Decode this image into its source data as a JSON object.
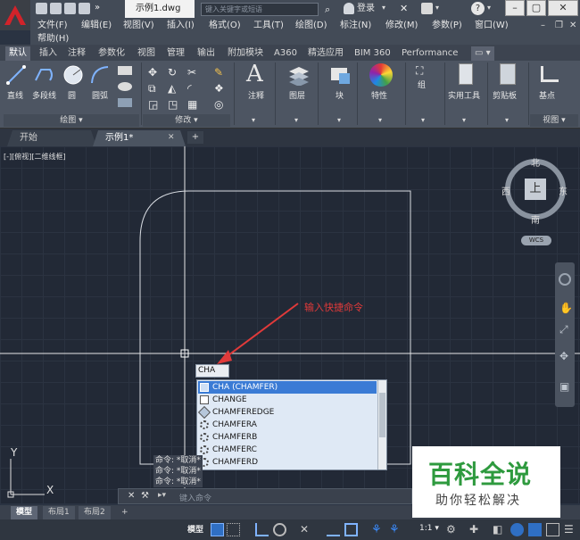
{
  "app": {
    "doc_title": "示例1.dwg",
    "search_placeholder": "键入关键字或短语",
    "login": "登录"
  },
  "menu": {
    "row1": [
      "文件(F)",
      "编辑(E)",
      "视图(V)",
      "插入(I)",
      "格式(O)",
      "工具(T)",
      "绘图(D)",
      "标注(N)",
      "修改(M)",
      "参数(P)",
      "窗口(W)"
    ],
    "row2": [
      "帮助(H)"
    ]
  },
  "ribbon": {
    "tabs": [
      "默认",
      "插入",
      "注释",
      "参数化",
      "视图",
      "管理",
      "输出",
      "附加模块",
      "A360",
      "精选应用",
      "BIM 360",
      "Performance"
    ],
    "active_tab": "默认",
    "buttons": {
      "line": "直线",
      "polyline": "多段线",
      "circle": "圆",
      "arc": "圆弧",
      "annotate": "注释",
      "layers": "图层",
      "block": "块",
      "properties": "特性",
      "group": "组",
      "utilities": "实用工具",
      "clipboard": "剪贴板",
      "base": "基点"
    },
    "panel_footers": {
      "draw": "绘图 ▾",
      "modify": "修改 ▾",
      "view": "视图 ▾"
    }
  },
  "doc_tabs": {
    "start": "开始",
    "current": "示例1*",
    "add": "+"
  },
  "viewport": {
    "label": "[-][俯视][二维线框]",
    "annotation": "输入快捷命令"
  },
  "viewcube": {
    "north": "北",
    "south": "南",
    "east": "东",
    "west": "西",
    "top": "上",
    "wcs": "WCS"
  },
  "ucs": {
    "x": "X",
    "y": "Y"
  },
  "command": {
    "typed": "CHA",
    "history": [
      "命令: *取消*",
      "命令: *取消*",
      "命令: *取消*"
    ],
    "placeholder": "键入命令",
    "suggestions": [
      "CHA (CHAMFER)",
      "CHANGE",
      "CHAMFEREDGE",
      "CHAMFERA",
      "CHAMFERB",
      "CHAMFERC",
      "CHAMFERD"
    ],
    "selected_index": 0
  },
  "layout_tabs": {
    "tabs": [
      "模型",
      "布局1",
      "布局2"
    ],
    "active": "模型",
    "add": "+"
  },
  "status": {
    "model": "模型",
    "scale": "1:1 ▾"
  },
  "watermark": {
    "title": "百科全说",
    "subtitle": "助你轻松解决"
  },
  "colors": {
    "accent": "#3a7bd5",
    "annotation_red": "#e03a3a",
    "watermark_green": "#2e9a3e"
  }
}
